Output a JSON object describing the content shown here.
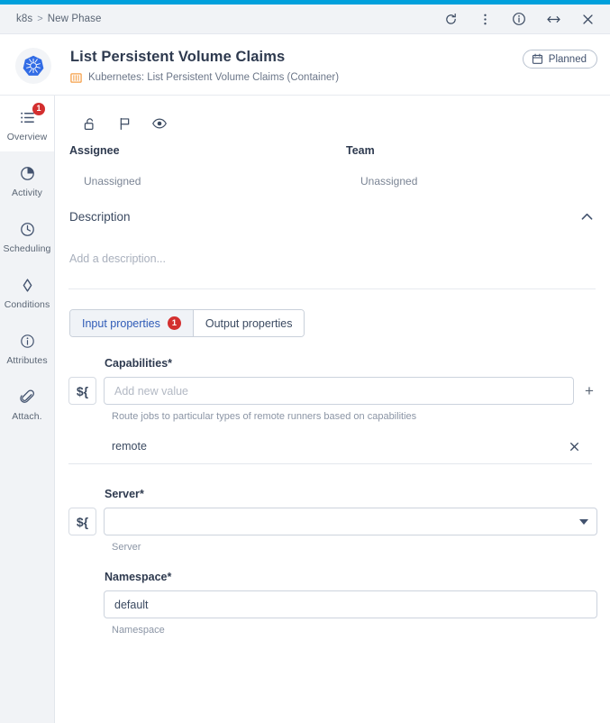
{
  "window": {
    "breadcrumb": {
      "root": "k8s",
      "separator": ">",
      "current": "New Phase"
    },
    "actions": [
      {
        "name": "refresh-icon",
        "label": "Refresh"
      },
      {
        "name": "more-menu-icon",
        "label": "More"
      },
      {
        "name": "info-icon",
        "label": "Info"
      },
      {
        "name": "resize-horizontal-icon",
        "label": "Resize"
      },
      {
        "name": "close-icon",
        "label": "Close"
      }
    ]
  },
  "header": {
    "logo": "kubernetes-logo",
    "title": "List Persistent Volume Claims",
    "subtitle": "Kubernetes: List Persistent Volume Claims (Container)",
    "subtitle_icon": "container-icon",
    "status": {
      "label": "Planned",
      "icon": "calendar-icon"
    }
  },
  "sidebar": {
    "items": [
      {
        "label": "Overview",
        "icon": "list-icon",
        "badge": "1",
        "active": true
      },
      {
        "label": "Activity",
        "icon": "activity-pie-icon",
        "badge": null,
        "active": false
      },
      {
        "label": "Scheduling",
        "icon": "clock-icon",
        "badge": null,
        "active": false
      },
      {
        "label": "Conditions",
        "icon": "diamond-icon",
        "badge": null,
        "active": false
      },
      {
        "label": "Attributes",
        "icon": "info-circle-icon",
        "badge": null,
        "active": false
      },
      {
        "label": "Attach.",
        "icon": "paperclip-icon",
        "badge": null,
        "active": false
      }
    ]
  },
  "toolbar": {
    "buttons": [
      {
        "name": "lock-open-icon",
        "label": "Lock"
      },
      {
        "name": "flag-icon",
        "label": "Flag"
      },
      {
        "name": "eye-icon",
        "label": "Watch"
      }
    ]
  },
  "meta": {
    "assignee": {
      "label": "Assignee",
      "value": "Unassigned"
    },
    "team": {
      "label": "Team",
      "value": "Unassigned"
    }
  },
  "description": {
    "title": "Description",
    "placeholder": "Add a description...",
    "collapse_icon": "chevron-up-icon",
    "expanded": true
  },
  "tabs": [
    {
      "label": "Input properties",
      "badge": "1",
      "active": true
    },
    {
      "label": "Output properties",
      "badge": null,
      "active": false
    }
  ],
  "form": {
    "expression_button_label": "${",
    "add_button_label": "+",
    "fields": [
      {
        "label": "Capabilities",
        "required_marker": "*",
        "type": "multi-value",
        "value": "",
        "placeholder": "Add new value",
        "help": "Route jobs to particular types of remote runners based on capabilities",
        "has_expression_button": true,
        "has_add_button": true,
        "chips": [
          {
            "text": "remote",
            "remove_icon": "close-icon"
          }
        ]
      },
      {
        "label": "Server",
        "required_marker": "*",
        "type": "select",
        "value": "",
        "help": "Server",
        "has_expression_button": true,
        "caret_icon": "chevron-down-icon"
      },
      {
        "label": "Namespace",
        "required_marker": "*",
        "type": "text",
        "value": "default",
        "help": "Namespace",
        "has_expression_button": false
      }
    ]
  },
  "colors": {
    "accent": "#00a0dc",
    "badge": "#d32f2f",
    "tab_active_text": "#2f5bb7",
    "kubernetes_blue": "#326ce5",
    "container_orange": "#f5a04a"
  }
}
